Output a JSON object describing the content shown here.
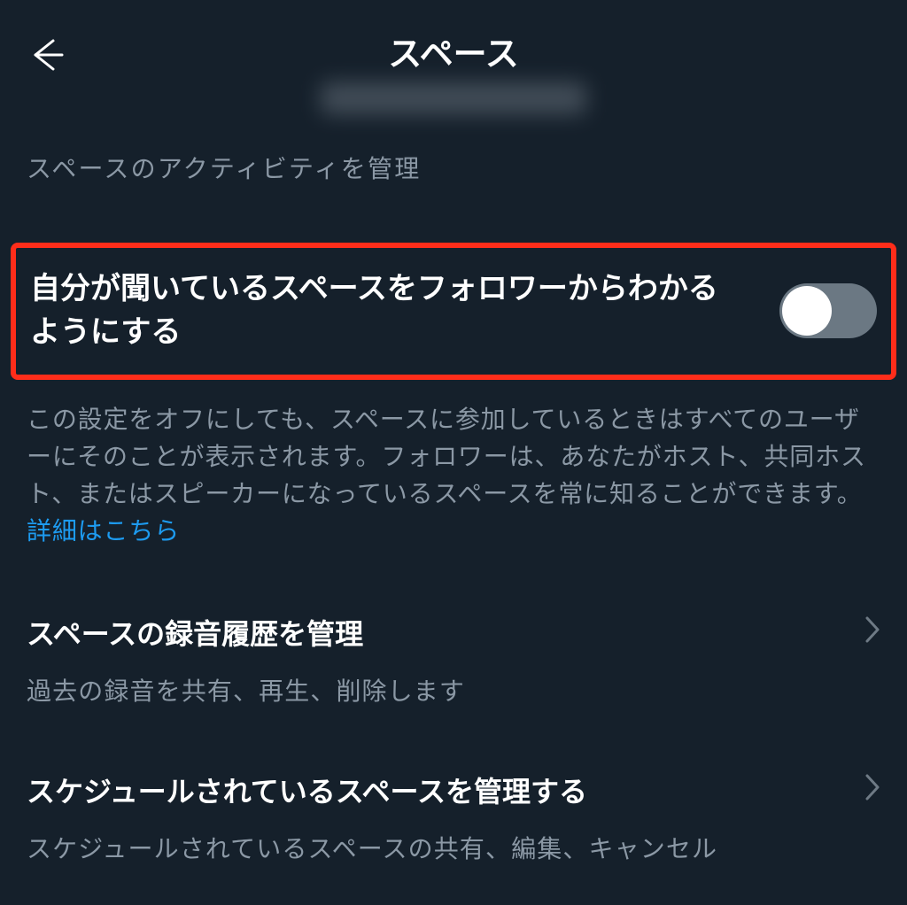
{
  "header": {
    "title": "スペース"
  },
  "section_label": "スペースのアクティビティを管理",
  "toggle_setting": {
    "label": "自分が聞いているスペースをフォロワーからわかるようにする",
    "enabled": false,
    "description": "この設定をオフにしても、スペースに参加しているときはすべてのユーザーにそのことが表示されます。フォロワーは、あなたがホスト、共同ホスト、またはスピーカーになっているスペースを常に知ることができます。",
    "link_label": "詳細はこちら"
  },
  "nav_items": [
    {
      "title": "スペースの録音履歴を管理",
      "description": "過去の録音を共有、再生、削除します"
    },
    {
      "title": "スケジュールされているスペースを管理する",
      "description": "スケジュールされているスペースの共有、編集、キャンセル"
    }
  ]
}
